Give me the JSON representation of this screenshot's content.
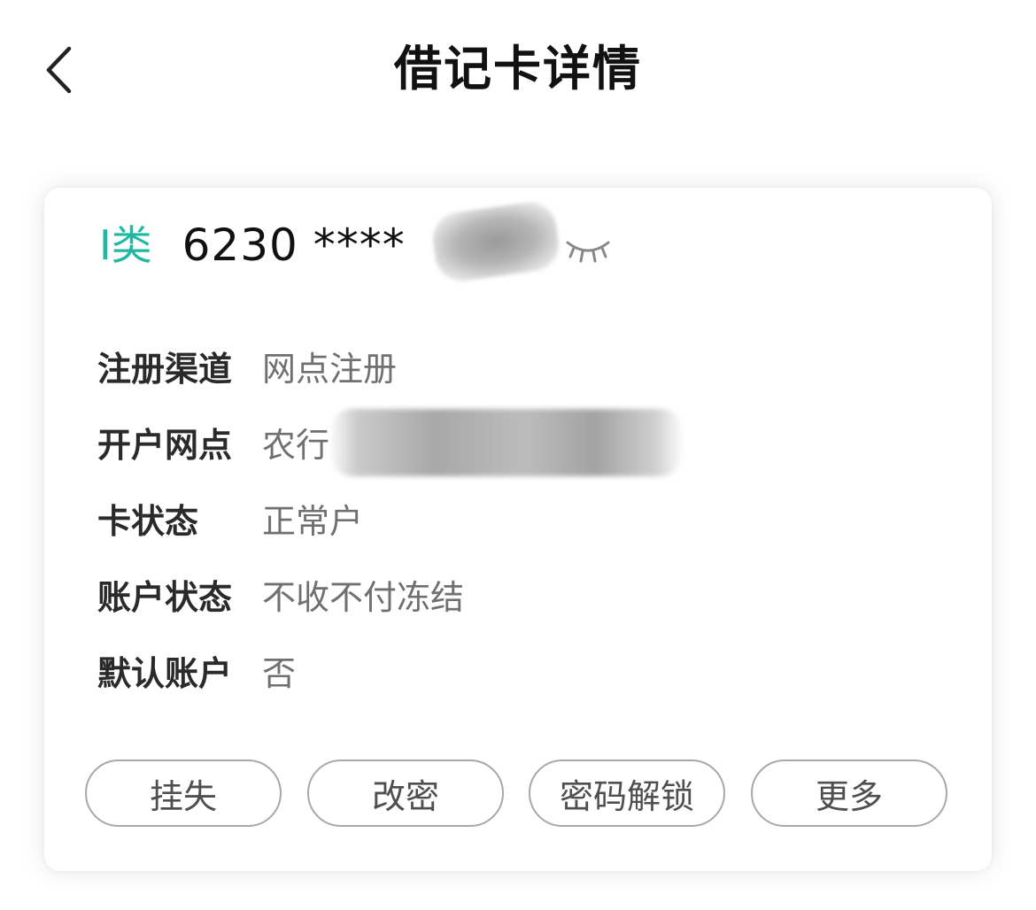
{
  "nav": {
    "title": "借记卡详情",
    "back_icon": "chevron-left-icon"
  },
  "card": {
    "type_label": "I类",
    "type_color": "#1fb9a3",
    "number_masked": "6230 ****",
    "visibility_icon": "eye-closed-icon"
  },
  "details": [
    {
      "label": "注册渠道",
      "value": "网点注册"
    },
    {
      "label": "开户网点",
      "value": "农行"
    },
    {
      "label": "卡状态",
      "value": "正常户"
    },
    {
      "label": "账户状态",
      "value": "不收不付冻结"
    },
    {
      "label": "默认账户",
      "value": "否"
    }
  ],
  "actions": [
    {
      "label": "挂失"
    },
    {
      "label": "改密"
    },
    {
      "label": "密码解锁"
    },
    {
      "label": "更多"
    }
  ]
}
